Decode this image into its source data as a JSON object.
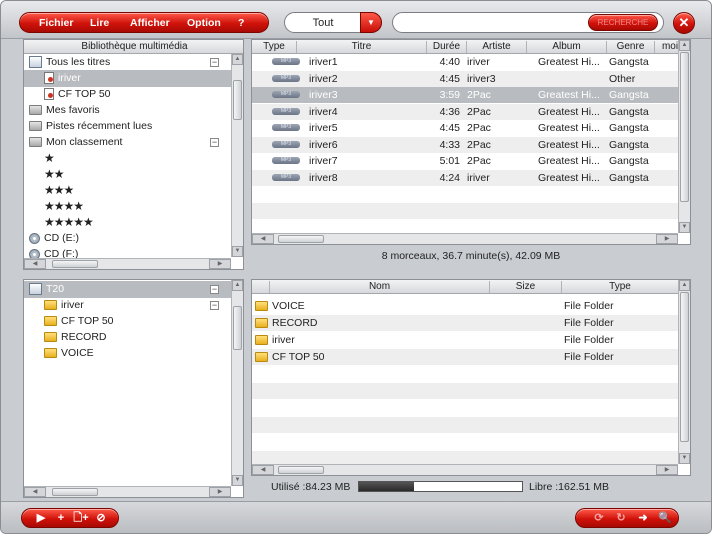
{
  "menu": {
    "items": [
      "Fichier",
      "Lire",
      "Afficher",
      "Option",
      "?"
    ]
  },
  "filter": {
    "value": "Tout"
  },
  "search": {
    "button_label": "RECHERCHE",
    "value": ""
  },
  "colors": {
    "accent_red": "#d0120a",
    "selected_row": "#b8bbbf",
    "alt_row": "#eeeeee"
  },
  "library": {
    "title": "Bibliothèque multimédia",
    "items": [
      {
        "label": "Tous les titres",
        "icon": "library-icon"
      },
      {
        "label": "iriver",
        "icon": "document-icon"
      },
      {
        "label": "CF TOP 50",
        "icon": "document-icon"
      },
      {
        "label": "Mes favoris",
        "icon": "gray-folder-icon"
      },
      {
        "label": "Pistes récemment lues",
        "icon": "gray-folder-icon"
      },
      {
        "label": "Mon classement",
        "icon": "gray-folder-icon"
      },
      {
        "label": "★",
        "icon": ""
      },
      {
        "label": "★★",
        "icon": ""
      },
      {
        "label": "★★★",
        "icon": ""
      },
      {
        "label": "★★★★",
        "icon": ""
      },
      {
        "label": "★★★★★",
        "icon": ""
      },
      {
        "label": "CD (E:)",
        "icon": "cd-icon"
      },
      {
        "label": "CD (F:)",
        "icon": "cd-icon"
      }
    ]
  },
  "tracks": {
    "columns": [
      "Type",
      "Titre",
      "Durée",
      "Artiste",
      "Album",
      "Genre",
      "moi"
    ],
    "rows": [
      {
        "type": "MP3",
        "title": "iriver1",
        "duration": "4:40",
        "artist": "iriver",
        "album": "Greatest Hi...",
        "genre": "Gangsta"
      },
      {
        "type": "MP3",
        "title": "iriver2",
        "duration": "4:45",
        "artist": "iriver3",
        "album": "",
        "genre": "Other"
      },
      {
        "type": "MP3",
        "title": "iriver3",
        "duration": "3:59",
        "artist": "2Pac",
        "album": "Greatest Hi...",
        "genre": "Gangsta"
      },
      {
        "type": "MP3",
        "title": "iriver4",
        "duration": "4:36",
        "artist": "2Pac",
        "album": "Greatest Hi...",
        "genre": "Gangsta"
      },
      {
        "type": "MP3",
        "title": "iriver5",
        "duration": "4:45",
        "artist": "2Pac",
        "album": "Greatest Hi...",
        "genre": "Gangsta"
      },
      {
        "type": "MP3",
        "title": "iriver6",
        "duration": "4:33",
        "artist": "2Pac",
        "album": "Greatest Hi...",
        "genre": "Gangsta"
      },
      {
        "type": "MP3",
        "title": "iriver7",
        "duration": "5:01",
        "artist": "2Pac",
        "album": "Greatest Hi...",
        "genre": "Gangsta"
      },
      {
        "type": "MP3",
        "title": "iriver8",
        "duration": "4:24",
        "artist": "iriver",
        "album": "Greatest Hi...",
        "genre": "Gangsta"
      }
    ],
    "status": "8 morceaux, 36.7 minute(s), 42.09 MB"
  },
  "device": {
    "title": "T20",
    "items": [
      "iriver",
      "CF TOP 50",
      "RECORD",
      "VOICE"
    ]
  },
  "files": {
    "columns": [
      "Nom",
      "Size",
      "Type"
    ],
    "rows": [
      {
        "name": "VOICE",
        "size": "",
        "type": "File Folder"
      },
      {
        "name": "RECORD",
        "size": "",
        "type": "File Folder"
      },
      {
        "name": "iriver",
        "size": "",
        "type": "File Folder"
      },
      {
        "name": "CF TOP 50",
        "size": "",
        "type": "File Folder"
      }
    ]
  },
  "storage": {
    "used_label": "Utilisé :84.23 MB",
    "free_label": "Libre :162.51 MB",
    "used_fraction": 0.34
  },
  "controls": {
    "left": [
      {
        "name": "play-icon",
        "glyph": "▶"
      },
      {
        "name": "add-icon",
        "glyph": "+"
      },
      {
        "name": "add-file-icon",
        "glyph": "🗋+"
      },
      {
        "name": "cancel-icon",
        "glyph": "⊘"
      }
    ],
    "right": [
      {
        "name": "sync-icon",
        "glyph": "⟳"
      },
      {
        "name": "refresh-icon",
        "glyph": "↻"
      },
      {
        "name": "transfer-icon",
        "glyph": "➜"
      },
      {
        "name": "search-icon",
        "glyph": "🔍"
      }
    ]
  }
}
